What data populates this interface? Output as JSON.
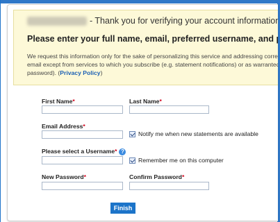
{
  "notice": {
    "thanks": "- Thank you for verifying your account information.",
    "heading": "Please enter your full name, email, preferred username, and password be",
    "body_line1": "We request this information only for the sake of personalizing this service and addressing correspor",
    "body_line2": "email except from services to which you subscribe (e.g. statement notifications) or as warranted by",
    "body_line3_prefix": "password). (",
    "privacy_link": "Privacy Policy",
    "body_line3_suffix": ")"
  },
  "form": {
    "first_name_label": "First Name",
    "last_name_label": "Last Name",
    "email_label": "Email Address",
    "notify_label": "Notify me when new statements are available",
    "username_label": "Please select a Username",
    "remember_label": "Remember me on this computer",
    "new_password_label": "New Password",
    "confirm_password_label": "Confirm Password",
    "required_mark": "*",
    "help_glyph": "?",
    "finish_label": "Finish"
  },
  "colors": {
    "accent": "#1c74c9",
    "notice_bg": "#fdf9d8",
    "required": "#d0021b"
  }
}
